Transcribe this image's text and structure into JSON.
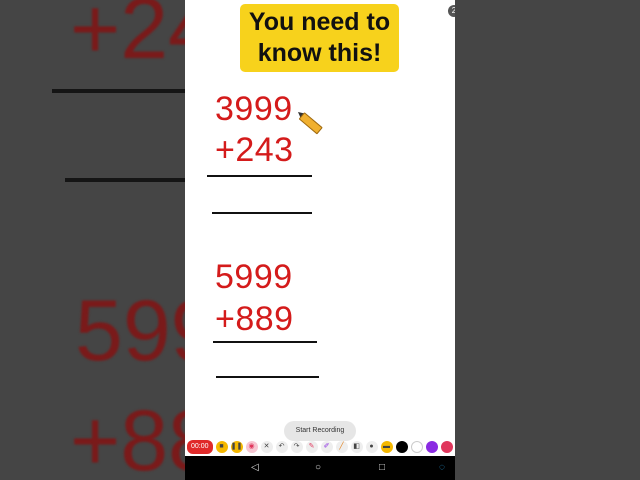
{
  "background": {
    "left_top": "+24",
    "left_mid": "599",
    "left_bottom": "+88"
  },
  "title": "You need to know this!",
  "corner_badge": "2",
  "problems": [
    {
      "top": "3999",
      "bottom": "+243"
    },
    {
      "top": "5999",
      "bottom": "+889"
    }
  ],
  "toast": "Start Recording",
  "toolbar": {
    "timer": "00:00",
    "icons": [
      "stop-icon",
      "pause-icon",
      "camera-icon",
      "close-icon",
      "undo-icon",
      "redo-icon",
      "pen-icon",
      "marker-icon",
      "eraser-icon",
      "highlighter-icon",
      "mic-icon",
      "folder-icon",
      "black-color-icon",
      "white-color-icon",
      "purple-color-icon",
      "pink-color-icon"
    ],
    "colors": {
      "timer": "#e02a2a",
      "stop": "#f5b800",
      "pause": "#f5b800",
      "camera": "#e0365c",
      "black": "#000000",
      "white": "#ffffff",
      "purple": "#8a2be2",
      "pink": "#e0365c"
    }
  },
  "navbar": {
    "back": "◁",
    "home": "○",
    "recents": "□"
  },
  "colors": {
    "title_bg": "#f7d21c",
    "digits": "#d41b1b"
  }
}
